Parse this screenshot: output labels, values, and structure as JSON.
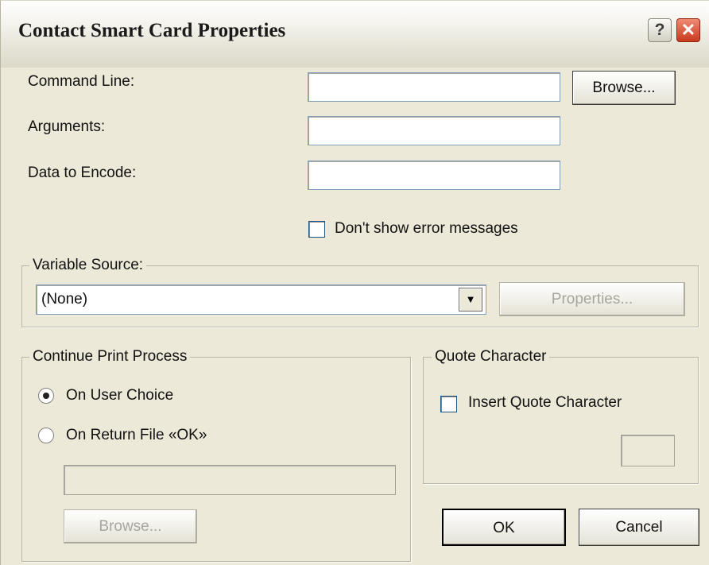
{
  "window": {
    "title": "Contact Smart Card Properties",
    "help_glyph": "?",
    "close_glyph": "✕"
  },
  "command_line": {
    "label": "Command Line:",
    "value": "",
    "browse_label": "Browse..."
  },
  "arguments": {
    "label": "Arguments:",
    "value": ""
  },
  "data_to_encode": {
    "label": "Data to Encode:",
    "value": ""
  },
  "dont_show_errors": {
    "label": "Don't show error messages",
    "checked": false
  },
  "variable_source": {
    "legend": "Variable Source:",
    "selected": "(None)",
    "properties_label": "Properties..."
  },
  "continue_print": {
    "legend": "Continue Print Process",
    "option_user_choice": "On User Choice",
    "option_return_file": "On Return File «OK»",
    "selected": "On User Choice",
    "file_value": "",
    "browse_label": "Browse..."
  },
  "quote_character": {
    "legend": "Quote Character",
    "insert_label": "Insert Quote Character",
    "checked": false,
    "value": ""
  },
  "footer": {
    "ok_label": "OK",
    "cancel_label": "Cancel"
  }
}
